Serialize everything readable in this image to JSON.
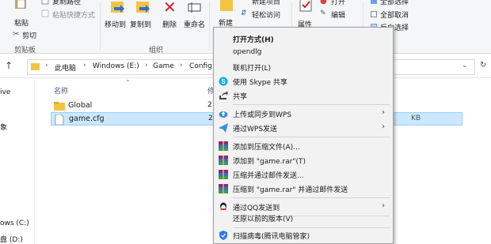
{
  "ribbon": {
    "copy_path": "复制路径",
    "paste": "粘贴",
    "paste_shortcut": "粘贴快捷方式",
    "cut": "剪切",
    "clipboard_group": "剪贴板",
    "move_to": "移动到",
    "copy_to": "复制到",
    "delete": "删除",
    "rename": "重命名",
    "organize_group": "组织",
    "new_folder": "新建",
    "new_item": "新建项目",
    "easy_access": "轻松访问",
    "properties": "属性",
    "open": "打开",
    "edit": "编辑",
    "select_all": "全部选择",
    "select_none": "全部取消",
    "invert_selection": "反向选择"
  },
  "address": {
    "crumbs": [
      "此电脑",
      "Windows (E:)",
      "Game",
      "Config"
    ]
  },
  "nav": {
    "partial_labels": [
      "ive",
      "象",
      "ows (C:)",
      "盘 (D:)"
    ]
  },
  "filelist": {
    "header_name": "名称",
    "header_partial": "修",
    "files": [
      {
        "name": "Global",
        "type": "folder",
        "date_partial": "2"
      },
      {
        "name": "game.cfg",
        "type": "file",
        "date_partial": "2",
        "size_partial": "KB"
      }
    ]
  },
  "context_menu": {
    "items": [
      {
        "label": "打开方式(H)",
        "bold": true
      },
      {
        "label": "opendlg"
      },
      {
        "label": "联机打开(L)"
      },
      {
        "label": "使用 Skype 共享",
        "icon": "skype-icon"
      },
      {
        "label": "共享",
        "icon": "share-icon"
      },
      {
        "label": "上传或同步到WPS",
        "icon": "wps-cloud-icon",
        "submenu": true
      },
      {
        "label": "通过WPS发送",
        "icon": "wps-send-icon",
        "submenu": true
      },
      {
        "label": "添加到压缩文件(A)...",
        "icon": "winrar-icon"
      },
      {
        "label": "添加到 \"game.rar\"(T)",
        "icon": "winrar-icon"
      },
      {
        "label": "压缩并通过邮件发送...",
        "icon": "winrar-icon"
      },
      {
        "label": "压缩到 \"game.rar\" 并通过邮件发送",
        "icon": "winrar-icon"
      },
      {
        "label": "通过QQ发送到",
        "icon": "qq-icon",
        "submenu": true
      },
      {
        "label": "还原以前的版本(V)"
      },
      {
        "label": "扫描病毒(腾讯电脑管家)",
        "icon": "tencent-shield-icon"
      }
    ]
  },
  "colors": {
    "selection": "#cce8ff",
    "menu_bg": "#f2f2f2",
    "ribbon_bg": "#f5f6f7",
    "folder": "#f3c342"
  }
}
